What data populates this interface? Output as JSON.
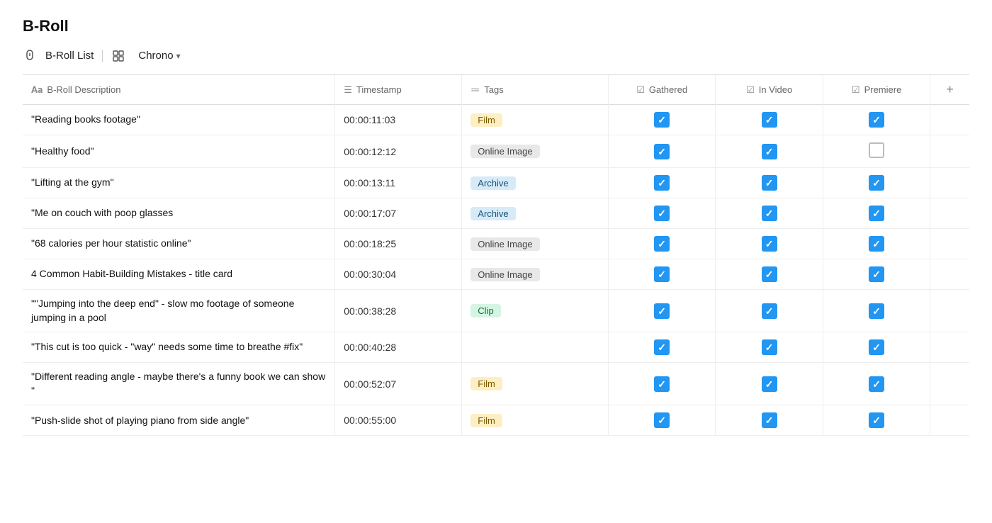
{
  "page": {
    "title": "B-Roll",
    "toolbar": {
      "list_label": "B-Roll List",
      "view_label": "Chrono",
      "view_caret": "▾"
    },
    "columns": [
      {
        "id": "desc",
        "label": "B-Roll Description",
        "icon": "text-icon"
      },
      {
        "id": "timestamp",
        "label": "Timestamp",
        "icon": "list-icon"
      },
      {
        "id": "tags",
        "label": "Tags",
        "icon": "tag-icon"
      },
      {
        "id": "gathered",
        "label": "Gathered",
        "icon": "check-icon"
      },
      {
        "id": "invideo",
        "label": "In Video",
        "icon": "check-icon"
      },
      {
        "id": "premiere",
        "label": "Premiere",
        "icon": "check-icon"
      },
      {
        "id": "add",
        "label": "+",
        "icon": ""
      }
    ],
    "rows": [
      {
        "desc": "\"Reading books footage\"",
        "timestamp": "00:00:11:03",
        "tag": "Film",
        "tag_type": "film",
        "gathered": true,
        "invideo": true,
        "premiere": true
      },
      {
        "desc": "\"Healthy food\"",
        "timestamp": "00:00:12:12",
        "tag": "Online Image",
        "tag_type": "online",
        "gathered": true,
        "invideo": true,
        "premiere": false
      },
      {
        "desc": "\"Lifting at the gym\"",
        "timestamp": "00:00:13:11",
        "tag": "Archive",
        "tag_type": "archive",
        "gathered": true,
        "invideo": true,
        "premiere": true
      },
      {
        "desc": "\"Me on couch with poop glasses",
        "timestamp": "00:00:17:07",
        "tag": "Archive",
        "tag_type": "archive",
        "gathered": true,
        "invideo": true,
        "premiere": true
      },
      {
        "desc": "\"68 calories per hour statistic online\"",
        "timestamp": "00:00:18:25",
        "tag": "Online Image",
        "tag_type": "online",
        "gathered": true,
        "invideo": true,
        "premiere": true
      },
      {
        "desc": "4 Common Habit-Building Mistakes - title card",
        "timestamp": "00:00:30:04",
        "tag": "Online Image",
        "tag_type": "online",
        "gathered": true,
        "invideo": true,
        "premiere": true
      },
      {
        "desc": "\"\"Jumping into the deep end\" - slow mo footage of someone jumping in a pool",
        "timestamp": "00:00:38:28",
        "tag": "Clip",
        "tag_type": "clip",
        "gathered": true,
        "invideo": true,
        "premiere": true
      },
      {
        "desc": "\"This cut is too quick - \"way\" needs some time to breathe #fix\"",
        "timestamp": "00:00:40:28",
        "tag": "",
        "tag_type": "",
        "gathered": true,
        "invideo": true,
        "premiere": true
      },
      {
        "desc": "\"Different reading angle - maybe there's a funny book we can show \"",
        "timestamp": "00:00:52:07",
        "tag": "Film",
        "tag_type": "film",
        "gathered": true,
        "invideo": true,
        "premiere": true
      },
      {
        "desc": "\"Push-slide shot of playing piano from side angle\"",
        "timestamp": "00:00:55:00",
        "tag": "Film",
        "tag_type": "film",
        "gathered": true,
        "invideo": true,
        "premiere": true
      }
    ]
  }
}
